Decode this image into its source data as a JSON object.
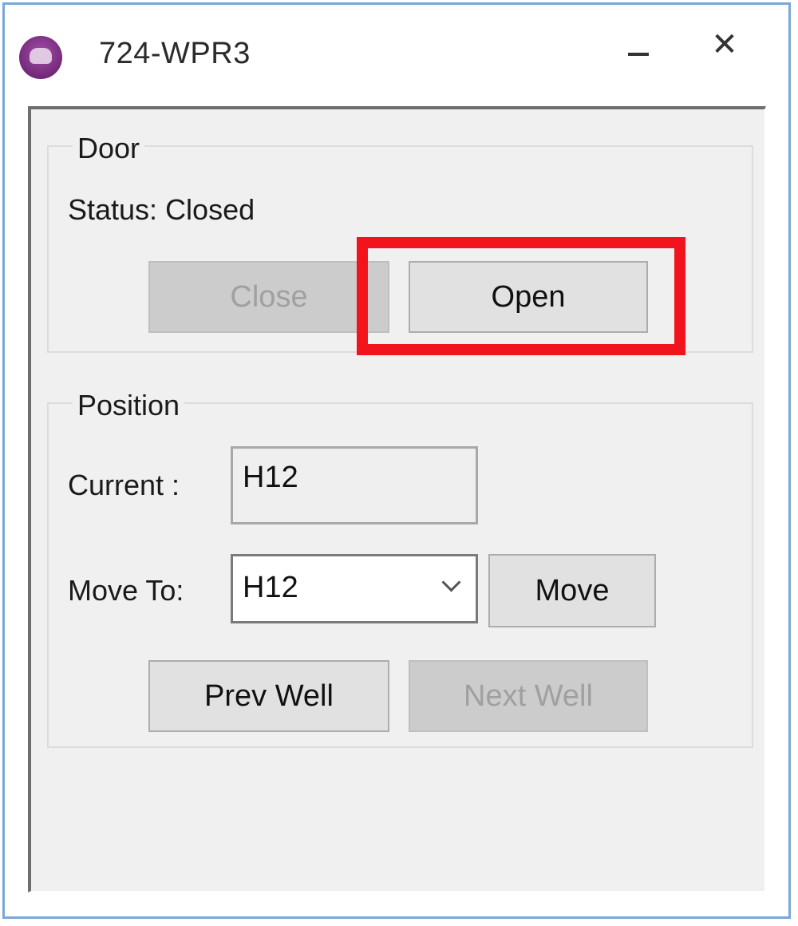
{
  "window": {
    "title": "724-WPR3",
    "minimize_glyph": "–",
    "close_glyph": "✕",
    "icon": "app-logo-icon"
  },
  "door": {
    "legend": "Door",
    "status_text": "Status: Closed",
    "close_label": "Close",
    "open_label": "Open"
  },
  "position": {
    "legend": "Position",
    "current_label": "Current :",
    "current_value": "H12",
    "move_to_label": "Move To:",
    "move_to_value": "H12",
    "move_label": "Move",
    "prev_well_label": "Prev Well",
    "next_well_label": "Next Well"
  },
  "colors": {
    "highlight": "#f2141c",
    "window_border": "#7aa7d8",
    "app_icon": "#7a2f80"
  }
}
